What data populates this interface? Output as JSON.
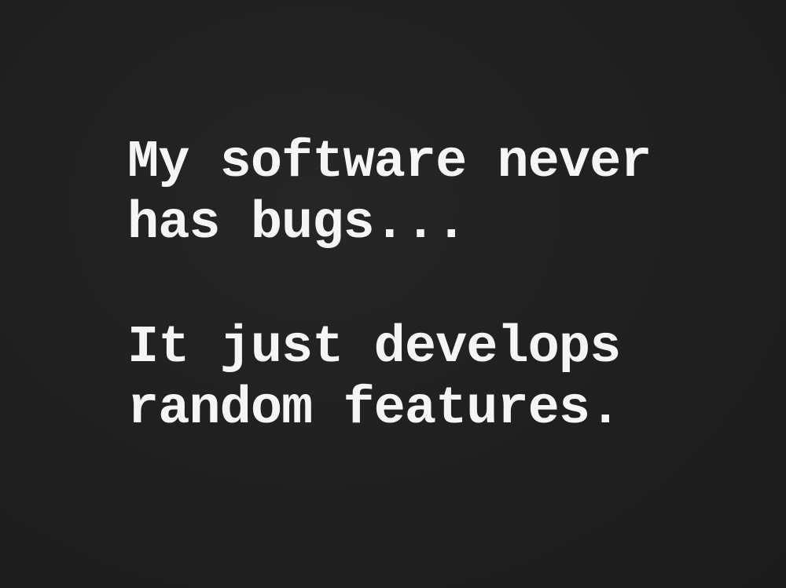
{
  "quote": {
    "paragraph_1": {
      "line_1": "My software never",
      "line_2": "has bugs..."
    },
    "paragraph_2": {
      "line_1": "It just develops",
      "line_2": "random features."
    }
  },
  "colors": {
    "background": "#1e1e1e",
    "text": "#f5f5f5"
  }
}
